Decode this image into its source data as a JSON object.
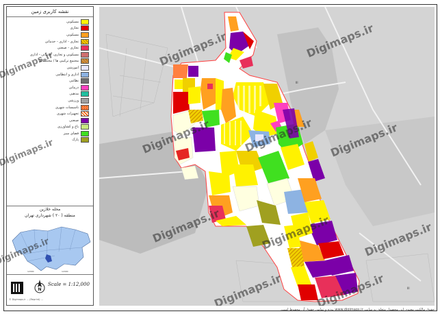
{
  "legend": {
    "title": "نقشه کاربری زمین",
    "items": [
      {
        "label": "مسکونی",
        "color": "#fff200"
      },
      {
        "label": "تجاری",
        "color": "#e00000"
      },
      {
        "label": "مسکونی",
        "color": "#ffa020"
      },
      {
        "label": "تجاری - اداری - خدماتی",
        "color": "#f0d000",
        "pattern": "hatch"
      },
      {
        "label": "تجاری - صنعتی",
        "color": "#e8305a"
      },
      {
        "label": "مسکونی و تجاری، خدماتی - اداری",
        "color": "#d07070"
      },
      {
        "label": "مجتمع ترکیبی ها / مختلط ها",
        "color": "#c89050",
        "pattern": "hatch"
      },
      {
        "label": "آموزشی",
        "color": "#e8e8ff"
      },
      {
        "label": "اداری و انتظامی",
        "color": "#8db3e2"
      },
      {
        "label": "نظامی",
        "color": "#6e6e6e"
      },
      {
        "label": "درمانی",
        "color": "#ff40c0"
      },
      {
        "label": "مذهبی",
        "color": "#20c0a0"
      },
      {
        "label": "ورزشی",
        "color": "#a0a0a0"
      },
      {
        "label": "تاسیسات شهری",
        "color": "#ff8040",
        "pattern": "dots"
      },
      {
        "label": "تجهیزات شهری",
        "color": "#ff6000",
        "pattern": "cross"
      },
      {
        "label": "صنعتی",
        "color": "#7b00a8"
      },
      {
        "label": "باغ و کشاورزی",
        "color": "#c8e880"
      },
      {
        "label": "فضای سبز",
        "color": "#40e020"
      },
      {
        "label": "پارک",
        "color": "#a0a020"
      }
    ]
  },
  "locator": {
    "title_line1": "محله خلازین",
    "title_line2": "منطقه ( ۲۰ ) شهرداری تهران"
  },
  "scale": "Scale = 1:12,000",
  "north_label": "N",
  "watermark": "Digimaps.ir",
  "footer": "حقوق مالکیت معنوی این محصول متعلق به سایت www.digimaps.ir بوده و تمامی حقوق آن محفوظ است.",
  "credit": "© Digimaps.ir ... (Reprint) ... "
}
